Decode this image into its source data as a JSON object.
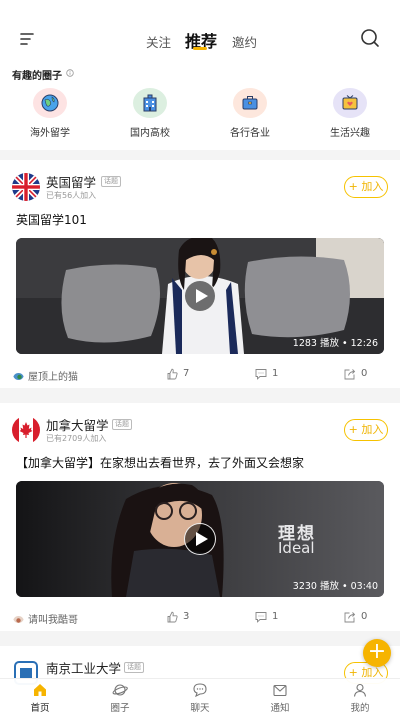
{
  "header": {
    "tabs": [
      {
        "label": "关注"
      },
      {
        "label": "推荐"
      },
      {
        "label": "邀约"
      }
    ],
    "active_tab": "推荐",
    "accent_color": "#f6b400"
  },
  "circles_section": {
    "title": "有趣的圈子",
    "categories": [
      {
        "label": "海外留学",
        "icon": "globe-icon"
      },
      {
        "label": "国内高校",
        "icon": "building-icon"
      },
      {
        "label": "各行各业",
        "icon": "briefcase-icon"
      },
      {
        "label": "生活兴趣",
        "icon": "tv-heart-icon"
      }
    ]
  },
  "posts": [
    {
      "circle": "英国留学",
      "badge": "话题",
      "members": "已有56人加入",
      "join_label": "+ 加入",
      "title": "英国留学101",
      "video_meta": "1283 播放 • 12:26",
      "author": "屋顶上的猫",
      "likes": "7",
      "comments": "1",
      "shares": "0"
    },
    {
      "circle": "加拿大留学",
      "badge": "话题",
      "members": "已有2709人加入",
      "join_label": "+ 加入",
      "title": "【加拿大留学】在家想出去看世界，去了外面又会想家",
      "video_meta": "3230 播放 • 03:40",
      "video_caption_cn": "理想",
      "video_caption_en": "Ideal",
      "author": "请叫我酷哥",
      "likes": "3",
      "comments": "1",
      "shares": "0"
    },
    {
      "circle": "南京工业大学",
      "badge": "话题",
      "join_label": "+ 加入"
    }
  ],
  "bottom_nav": [
    {
      "label": "首页",
      "icon": "home-icon"
    },
    {
      "label": "圈子",
      "icon": "planet-icon"
    },
    {
      "label": "聊天",
      "icon": "chat-icon"
    },
    {
      "label": "通知",
      "icon": "mail-icon"
    },
    {
      "label": "我的",
      "icon": "person-icon"
    }
  ],
  "fab_label": "+"
}
